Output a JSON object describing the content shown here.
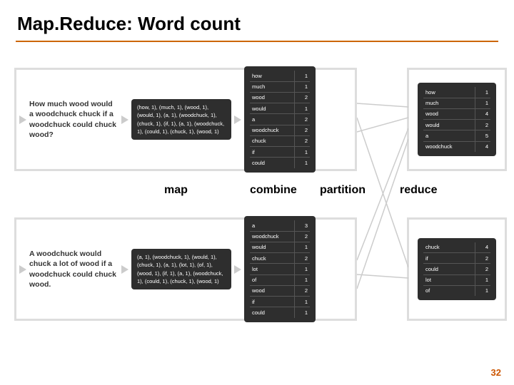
{
  "title": "Map.Reduce: Word count",
  "page_number": "32",
  "stages": {
    "map": "map",
    "combine": "combine",
    "partition": "partition",
    "reduce": "reduce"
  },
  "top": {
    "input": "How much wood would a woodchuck chuck if a woodchuck could chuck wood?",
    "map_output": "(how, 1), (much, 1), (wood, 1), (would, 1), (a, 1), (woodchuck, 1), (chuck, 1), (if, 1), (a, 1), (woodchuck, 1), (could, 1), (chuck, 1), (wood, 1)",
    "combine": [
      [
        "how",
        "1"
      ],
      [
        "much",
        "1"
      ],
      [
        "wood",
        "2"
      ],
      [
        "would",
        "1"
      ],
      [
        "a",
        "2"
      ],
      [
        "woodchuck",
        "2"
      ],
      [
        "chuck",
        "2"
      ],
      [
        "if",
        "1"
      ],
      [
        "could",
        "1"
      ]
    ],
    "reduce": [
      [
        "how",
        "1"
      ],
      [
        "much",
        "1"
      ],
      [
        "wood",
        "4"
      ],
      [
        "would",
        "2"
      ],
      [
        "a",
        "5"
      ],
      [
        "woodchuck",
        "4"
      ]
    ]
  },
  "bottom": {
    "input": "A woodchuck would chuck a lot of wood if a woodchuck could chuck wood.",
    "map_output": "(a, 1), (woodchuck, 1), (would, 1), (chuck, 1), (a, 1), (lot, 1), (of, 1), (wood, 1), (if, 1), (a, 1), (woodchuck, 1), (could, 1), (chuck, 1), (wood, 1)",
    "combine": [
      [
        "a",
        "3"
      ],
      [
        "woodchuck",
        "2"
      ],
      [
        "would",
        "1"
      ],
      [
        "chuck",
        "2"
      ],
      [
        "lot",
        "1"
      ],
      [
        "of",
        "1"
      ],
      [
        "wood",
        "2"
      ],
      [
        "if",
        "1"
      ],
      [
        "could",
        "1"
      ]
    ],
    "reduce": [
      [
        "chuck",
        "4"
      ],
      [
        "if",
        "2"
      ],
      [
        "could",
        "2"
      ],
      [
        "lot",
        "1"
      ],
      [
        "of",
        "1"
      ]
    ]
  }
}
